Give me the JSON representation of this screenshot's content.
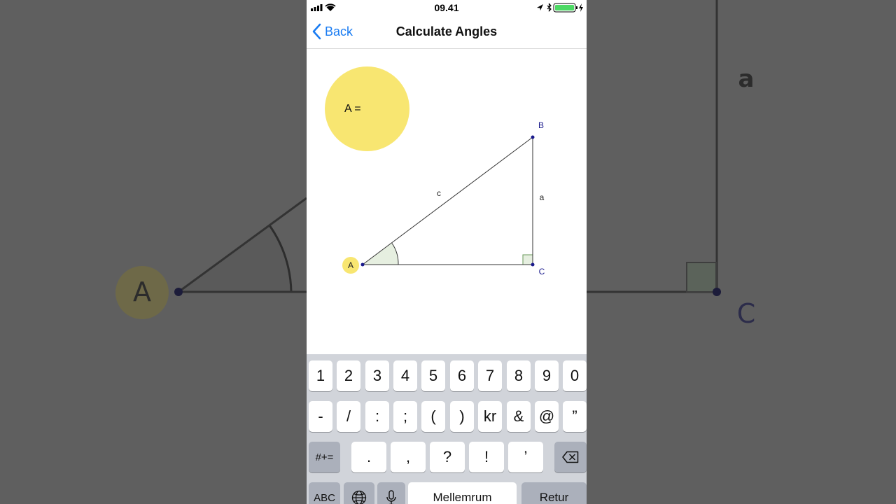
{
  "background": {
    "label_a": "a",
    "label_A": "A",
    "label_C": "C"
  },
  "status_bar": {
    "time": "09.41"
  },
  "nav": {
    "back_label": "Back",
    "title": "Calculate Angles"
  },
  "canvas": {
    "answer_label": "A =",
    "vertices": {
      "A": "A",
      "B": "B",
      "C": "C"
    },
    "sides": {
      "a": "a",
      "c": "c"
    },
    "colors": {
      "answer_bubble": "#f8e671",
      "angle_fill": "#e6efe0",
      "vertex_point": "#1a1a8c"
    }
  },
  "keyboard": {
    "row1": [
      "1",
      "2",
      "3",
      "4",
      "5",
      "6",
      "7",
      "8",
      "9",
      "0"
    ],
    "row2": [
      "-",
      "/",
      ":",
      ";",
      "(",
      ")",
      "kr",
      "&",
      "@",
      "”"
    ],
    "row3": {
      "mode_key": "#+=",
      "keys": [
        ".",
        ",",
        "?",
        "!",
        "’"
      ],
      "delete_icon": "backspace-icon"
    },
    "row4": {
      "abc_key": "ABC",
      "globe_icon": "globe-icon",
      "mic_icon": "microphone-icon",
      "space": "Mellemrum",
      "return": "Retur"
    }
  }
}
